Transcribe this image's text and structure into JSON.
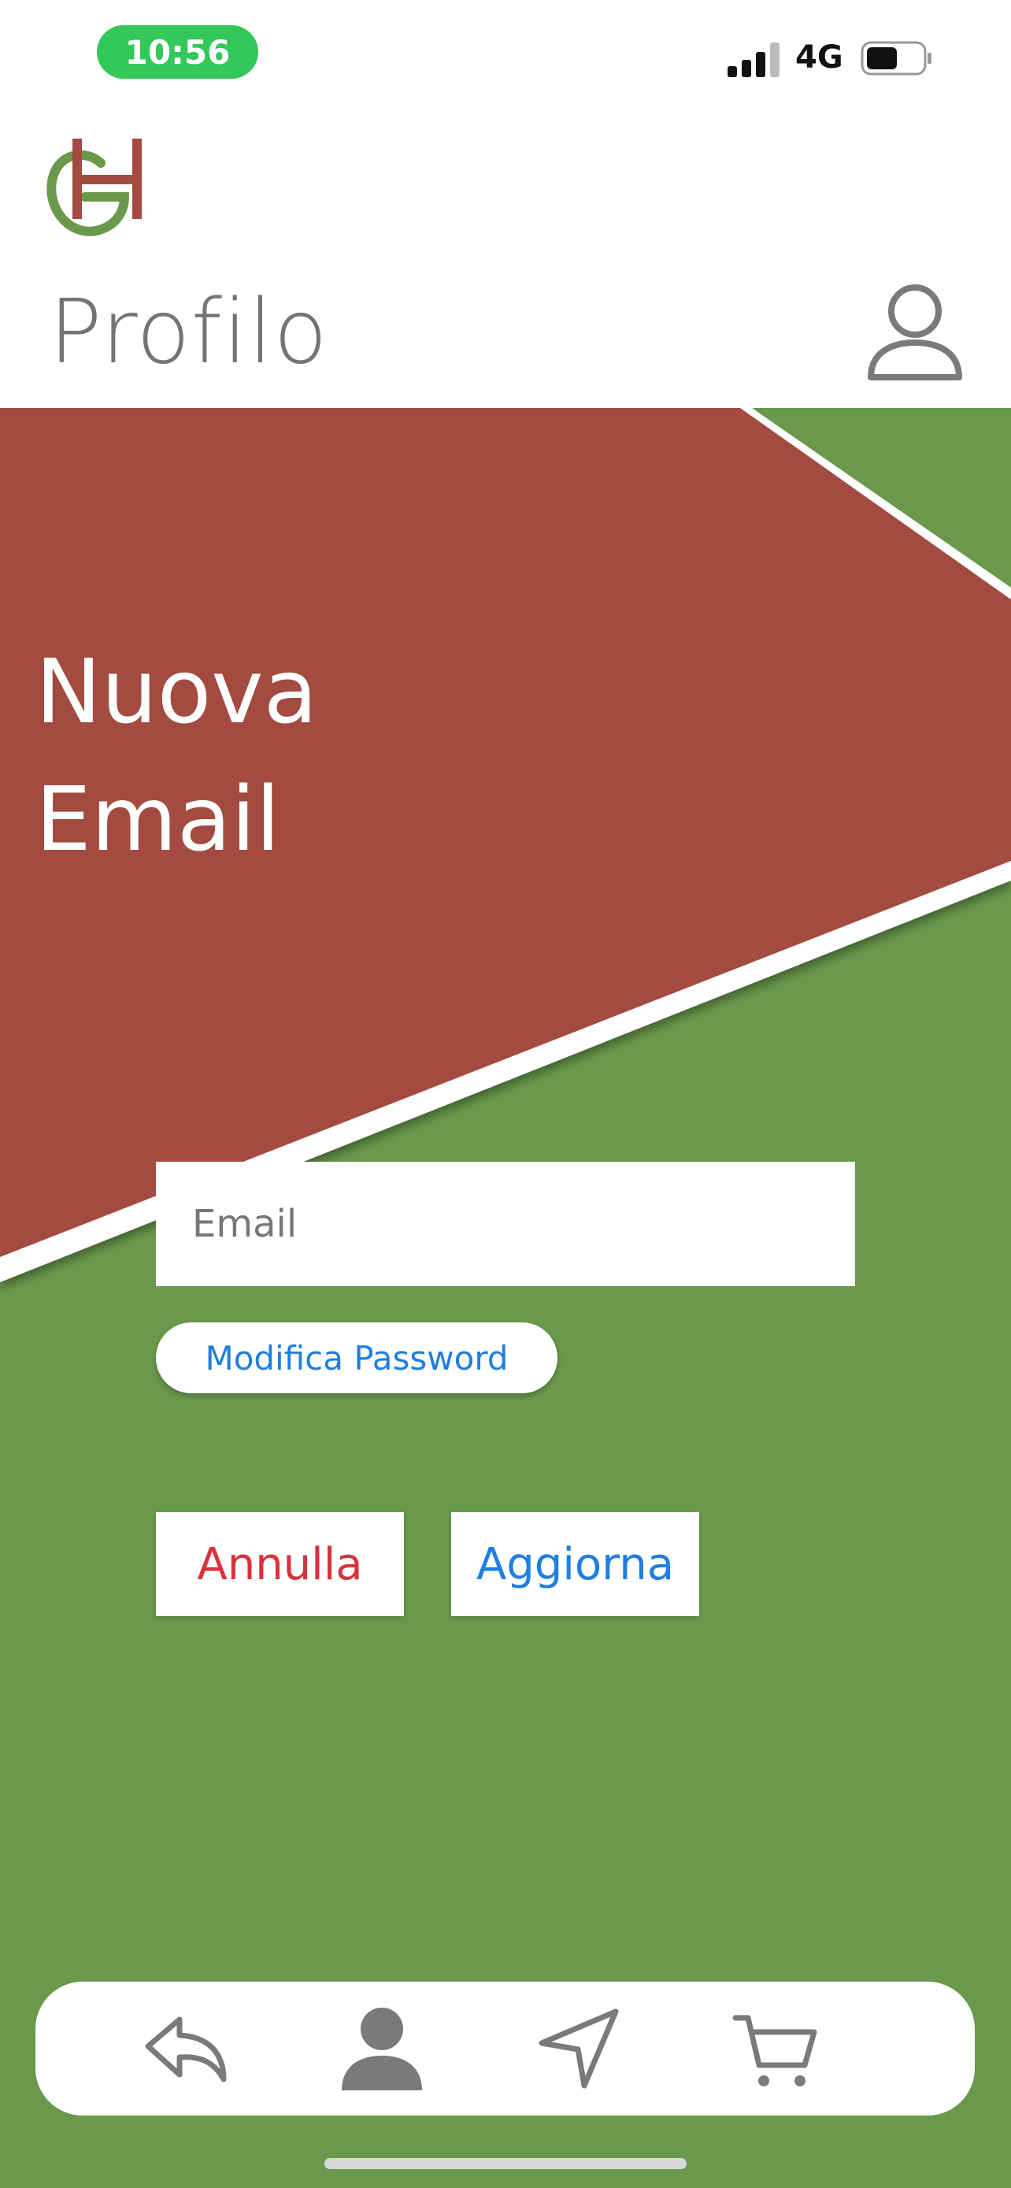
{
  "status_bar": {
    "time": "10:56",
    "network": "4G"
  },
  "header": {
    "title": "Profilo",
    "logo_icon": "gh-logo-icon",
    "profile_icon": "user-outline-icon"
  },
  "hero": {
    "title_line1": "Nuova",
    "title_line2": "Email"
  },
  "form": {
    "email_placeholder": "Email",
    "email_value": "",
    "change_password_label": "Modifica Password",
    "cancel_label": "Annulla",
    "update_label": "Aggiorna"
  },
  "tab_bar": {
    "icons": [
      "back-arrow-icon",
      "user-filled-icon",
      "navigation-arrow-icon",
      "cart-icon"
    ]
  },
  "colors": {
    "green": "#6a994c",
    "red": "#a34b41",
    "blue": "#1f7fe0",
    "cancel_red": "#d9323c",
    "time_pill": "#34c759",
    "title_gray": "#747474"
  }
}
